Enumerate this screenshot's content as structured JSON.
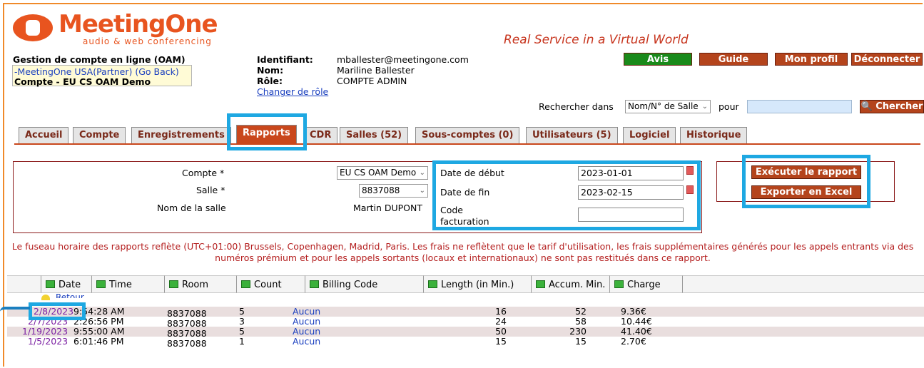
{
  "brand": {
    "name": "MeetingOne",
    "subtitle": "audio & web conferencing",
    "tagline": "Real Service in a Virtual World"
  },
  "account": {
    "section_title": "Gestion de compte en ligne (OAM)",
    "partner_link": "-MeetingOne USA(Partner) (Go Back)",
    "account_name": "Compte - EU CS OAM Demo"
  },
  "user": {
    "id_label": "Identifiant:",
    "id_value": "mballester@meetingone.com",
    "name_label": "Nom:",
    "name_value": "Mariline Ballester",
    "role_label": "Rôle:",
    "role_value": "COMPTE ADMIN",
    "change_role": "Changer de rôle"
  },
  "top_buttons": {
    "avis": "Avis",
    "guide": "Guide",
    "profile": "Mon profil",
    "logout": "Déconnecter"
  },
  "search": {
    "label": "Rechercher dans",
    "scope": "Nom/N° de Salle",
    "for_label": "pour",
    "value": "",
    "button": "Chercher"
  },
  "tabs": [
    "Accueil",
    "Compte",
    "Enregistrements",
    "Rapports",
    "CDR",
    "Salles (52)",
    "Sous-comptes (0)",
    "Utilisateurs (5)",
    "Logiciel",
    "Historique"
  ],
  "form": {
    "account_label": "Compte *",
    "account_value": "EU CS OAM Demo",
    "room_label": "Salle *",
    "room_value": "8837088",
    "room_name_label": "Nom de la salle",
    "room_name_value": "Martin DUPONT",
    "start_label": "Date de début",
    "start_value": "2023-01-01",
    "end_label": "Date de fin",
    "end_value": "2023-02-15",
    "billing_label": "Code facturation",
    "billing_value": "",
    "run_button": "Exécuter le rapport",
    "export_button": "Exporter en Excel"
  },
  "notice_line1": "Le fuseau horaire des rapports reflète (UTC+01:00) Brussels, Copenhagen, Madrid, Paris. Les frais ne reflètent que le tarif d'utilisation, les frais supplémentaires générés pour les appels entrants via des",
  "notice_line2": "numéros prémium et pour les appels sortants (locaux et internationaux) ne sont pas restitués dans ce rapport.",
  "table": {
    "headers": [
      "Date",
      "Time",
      "Room",
      "Count",
      "Billing Code",
      "Length (in Min.)",
      "Accum. Min.",
      "Charge"
    ],
    "back_link": "Retour",
    "rows": [
      {
        "date": "2/8/2023",
        "time": "9:54:28 AM",
        "room": "8837088",
        "count": "5",
        "billing": "Aucun",
        "length": "16",
        "accum": "52",
        "charge": "9.36€"
      },
      {
        "date": "2/7/2023",
        "time": "2:26:56 PM",
        "room": "8837088",
        "count": "3",
        "billing": "Aucun",
        "length": "24",
        "accum": "58",
        "charge": "10.44€"
      },
      {
        "date": "1/19/2023",
        "time": "9:55:00 AM",
        "room": "8837088",
        "count": "5",
        "billing": "Aucun",
        "length": "50",
        "accum": "230",
        "charge": "41.40€"
      },
      {
        "date": "1/5/2023",
        "time": "6:01:46 PM",
        "room": "8837088",
        "count": "1",
        "billing": "Aucun",
        "length": "15",
        "accum": "15",
        "charge": "2.70€"
      }
    ]
  },
  "colors": {
    "accent": "#c9471c",
    "highlight": "#1ea8e2",
    "avis_button": "#1a8a1a",
    "notice": "#b41e1e"
  }
}
